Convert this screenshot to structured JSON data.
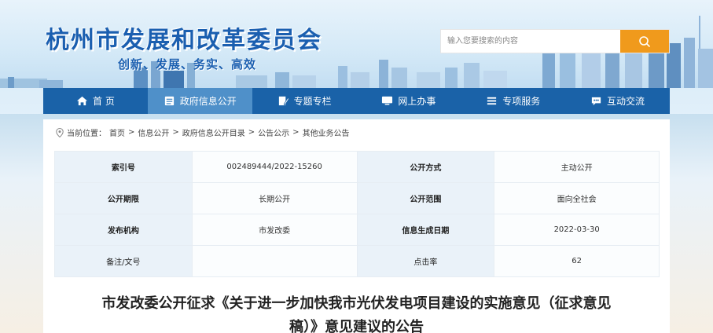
{
  "header": {
    "site_title": "杭州市发展和改革委员会",
    "slogan": "创新、发展、务实、高效",
    "search_placeholder": "输入您要搜索的内容"
  },
  "nav": {
    "items": [
      {
        "label": "首 页",
        "icon": "home-icon"
      },
      {
        "label": "政府信息公开",
        "icon": "document-icon"
      },
      {
        "label": "专题专栏",
        "icon": "edit-icon"
      },
      {
        "label": "网上办事",
        "icon": "monitor-icon"
      },
      {
        "label": "专项服务",
        "icon": "list-icon"
      },
      {
        "label": "互动交流",
        "icon": "chat-icon"
      }
    ],
    "active_index": 1
  },
  "breadcrumb": {
    "prefix": "当前位置：",
    "items": [
      "首页",
      "信息公开",
      "政府信息公开目录",
      "公告公示",
      "其他业务公告"
    ],
    "separator": ">"
  },
  "meta": {
    "rows": [
      {
        "k1": "索引号",
        "v1": "002489444/2022-15260",
        "k2": "公开方式",
        "v2": "主动公开"
      },
      {
        "k1": "公开期限",
        "v1": "长期公开",
        "k2": "公开范围",
        "v2": "面向全社会"
      },
      {
        "k1": "发布机构",
        "v1": "市发改委",
        "k2": "信息生成日期",
        "v2": "2022-03-30"
      },
      {
        "k1": "备注/文号",
        "v1": "",
        "k2": "点击率",
        "v2": "62"
      }
    ]
  },
  "document": {
    "title_line1": "市发改委公开征求《关于进一步加快我市光伏发电项目建设的实施意见（征求意见",
    "title_line2": "稿）》意见建议的公告"
  },
  "colors": {
    "brand_blue": "#1a62a8",
    "nav_active": "#4f90c9",
    "search_button": "#f09a1c",
    "title_blue": "#1b5fb0"
  }
}
